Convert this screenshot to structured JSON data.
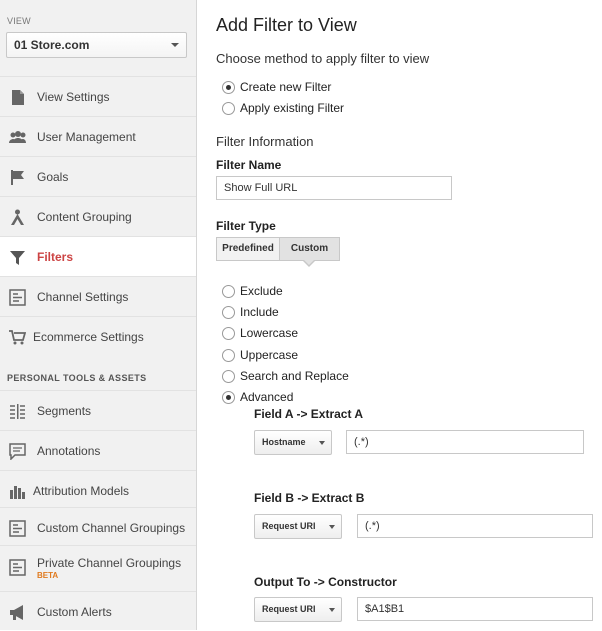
{
  "sidebar": {
    "view_label": "VIEW",
    "view_selected": "01 Store.com",
    "items": [
      {
        "label": "View Settings",
        "icon": "document-icon"
      },
      {
        "label": "User Management",
        "icon": "users-icon"
      },
      {
        "label": "Goals",
        "icon": "flag-icon"
      },
      {
        "label": "Content Grouping",
        "icon": "content-grouping-icon"
      },
      {
        "label": "Filters",
        "icon": "filter-icon",
        "active": true
      },
      {
        "label": "Channel Settings",
        "icon": "channel-settings-icon"
      },
      {
        "label": "Ecommerce Settings",
        "icon": "cart-icon"
      }
    ],
    "section_heading": "PERSONAL TOOLS & ASSETS",
    "tools": [
      {
        "label": "Segments",
        "icon": "segments-icon"
      },
      {
        "label": "Annotations",
        "icon": "annotation-icon"
      },
      {
        "label": "Attribution Models",
        "icon": "bar-chart-icon"
      },
      {
        "label": "Custom Channel Groupings",
        "icon": "channel-grouping-icon"
      },
      {
        "label": "Private Channel Groupings",
        "icon": "channel-grouping-icon",
        "badge": "BETA"
      },
      {
        "label": "Custom Alerts",
        "icon": "megaphone-icon"
      }
    ],
    "accent_color": "#c44444"
  },
  "main": {
    "title": "Add Filter to View",
    "method_heading": "Choose method to apply filter to view",
    "method_options": [
      {
        "label": "Create new Filter",
        "selected": true
      },
      {
        "label": "Apply existing Filter",
        "selected": false
      }
    ],
    "info_heading": "Filter Information",
    "filter_name_label": "Filter Name",
    "filter_name_value": "Show Full URL",
    "filter_type_label": "Filter Type",
    "type_tabs": [
      {
        "label": "Predefined",
        "selected": false
      },
      {
        "label": "Custom",
        "selected": true
      }
    ],
    "custom_options": [
      {
        "label": "Exclude",
        "selected": false
      },
      {
        "label": "Include",
        "selected": false
      },
      {
        "label": "Lowercase",
        "selected": false
      },
      {
        "label": "Uppercase",
        "selected": false
      },
      {
        "label": "Search and Replace",
        "selected": false
      },
      {
        "label": "Advanced",
        "selected": true
      }
    ],
    "field_a": {
      "label": "Field A -> Extract A",
      "field": "Hostname",
      "value": "(.*)"
    },
    "field_b": {
      "label": "Field B -> Extract B",
      "field": "Request URI",
      "value": "(.*)"
    },
    "output": {
      "label": "Output To -> Constructor",
      "field": "Request URI",
      "value": "$A1$B1"
    }
  }
}
